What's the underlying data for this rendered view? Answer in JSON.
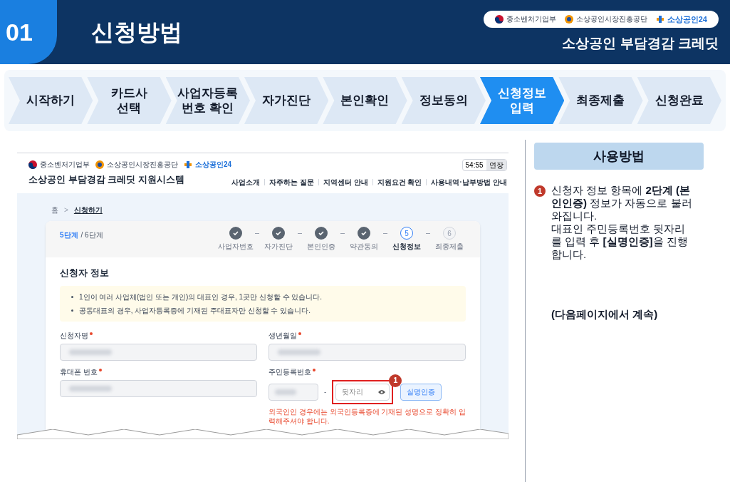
{
  "header": {
    "number": "01",
    "title": "신청방법",
    "logos": [
      "중소벤처기업부",
      "소상공인시장진흥공단",
      "소상공인24"
    ],
    "subtitle": "소상공인 부담경감 크레딧"
  },
  "steps": [
    {
      "label": "시작하기",
      "selected": false
    },
    {
      "label": "카드사\n선택",
      "selected": false
    },
    {
      "label": "사업자등록\n번호 확인",
      "selected": false
    },
    {
      "label": "자가진단",
      "selected": false
    },
    {
      "label": "본인확인",
      "selected": false
    },
    {
      "label": "정보동의",
      "selected": false
    },
    {
      "label": "신청정보\n입력",
      "selected": true
    },
    {
      "label": "최종제출",
      "selected": false
    },
    {
      "label": "신청완료",
      "selected": false
    }
  ],
  "screenshot": {
    "logos": [
      "중소벤처기업부",
      "소상공인시장진흥공단",
      "소상공인24"
    ],
    "site_title": "소상공인 부담경감 크레딧 지원시스템",
    "timer": "54:55",
    "extend_button": "연장",
    "nav": [
      "사업소개",
      "자주하는 질문",
      "지역센터 안내",
      "지원요건 확인",
      "사용내역·납부방법 안내"
    ],
    "breadcrumb": {
      "home": "홈",
      "separator": ">",
      "current": "신청하기"
    },
    "current_step": "5단계",
    "total_steps": "/ 6단계",
    "progress_steps": [
      {
        "label": "사업자번호",
        "completed": true,
        "selected": false
      },
      {
        "label": "자가진단",
        "completed": true,
        "selected": false
      },
      {
        "label": "본인인증",
        "completed": true,
        "selected": false
      },
      {
        "label": "약관동의",
        "completed": true,
        "selected": false
      },
      {
        "label": "신청정보",
        "number": "5",
        "completed": false,
        "selected": true
      },
      {
        "label": "최종제출",
        "number": "6",
        "completed": false,
        "selected": false
      }
    ],
    "section_title": "신청자 정보",
    "notices": [
      "1인이 여러 사업체(법인 또는 개인)의 대표인 경우, 1곳만 신청할 수 있습니다.",
      "공동대표의 경우, 사업자등록증에 기재된 주대표자만 신청할 수 있습니다."
    ],
    "fields": [
      {
        "kind": "text",
        "label": "신청자명",
        "required": true
      },
      {
        "kind": "text",
        "label": "생년월일",
        "required": true
      },
      {
        "kind": "text",
        "label": "휴대폰 번호",
        "required": true
      },
      {
        "kind": "rrn",
        "label": "주민등록번호",
        "required": true,
        "separator": "-",
        "placeholder": "뒷자리",
        "button": "실명인증",
        "callout": "1",
        "error": "외국인인 경우에는 외국인등록증에 기재된 성명으로 정확히 입력해주셔야 합니다."
      }
    ]
  },
  "usage": {
    "title": "사용방법",
    "items": [
      {
        "number": "1",
        "paragraphs": [
          "신청자 정보 항목에 **2단계 (본인인증)** 정보가 자동으로 불러와집니다.",
          "대표인 주민등록번호 뒷자리를 입력 후 **[실명인증]**을 진행합니다."
        ]
      }
    ],
    "note": "(다음페이지에서 계속)"
  }
}
